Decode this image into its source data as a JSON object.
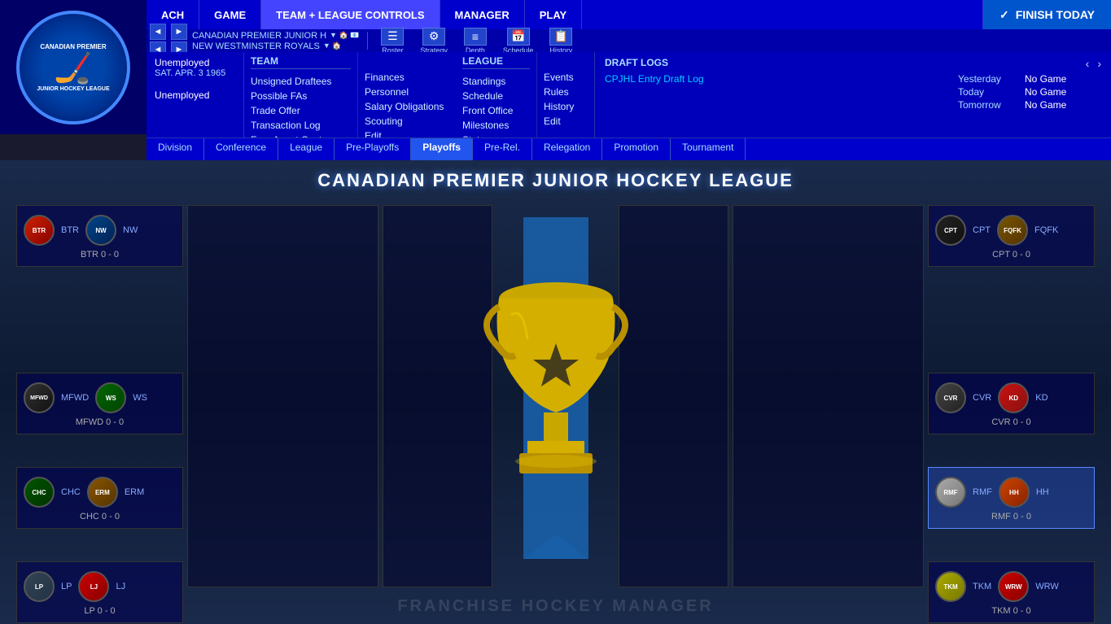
{
  "topNav": {
    "items": [
      {
        "label": "ACH",
        "active": false
      },
      {
        "label": "GAME",
        "active": false
      },
      {
        "label": "TEAM + LEAGUE CONTROLS",
        "active": true
      },
      {
        "label": "MANAGER",
        "active": false
      },
      {
        "label": "PLAY",
        "active": false
      }
    ],
    "finishToday": "FINISH TODAY"
  },
  "teamLinks": {
    "line1": "CANADIAN PREMIER JUNIOR H",
    "line2": "NEW WESTMINSTER ROYALS"
  },
  "toolbar": {
    "buttons": [
      "Roster",
      "Strategy",
      "Depth",
      "Schedule",
      "History"
    ]
  },
  "teamMenu": {
    "title": "TEAM",
    "items": [
      "Unsigned Draftees",
      "Possible FAs",
      "Trade Offer",
      "Transaction Log",
      "Free Agent Centre"
    ]
  },
  "leagueMenu": {
    "title": "LEAGUE",
    "items": [
      "Standings",
      "Schedule",
      "Front Office",
      "Milestones",
      "Stats"
    ]
  },
  "teamSubmenu": {
    "items": [
      "Finances",
      "Personnel",
      "Salary Obligations",
      "Scouting",
      "Edit"
    ]
  },
  "leagueSubmenu": {
    "items": [
      "Events",
      "Rules",
      "History",
      "Edit"
    ]
  },
  "draftLogs": {
    "title": "DRAFT LOGS",
    "link": "CPJHL Entry Draft Log"
  },
  "calendar": {
    "yesterday": {
      "label": "Yesterday",
      "value": "No Game"
    },
    "today": {
      "label": "Today",
      "value": "No Game"
    },
    "tomorrow": {
      "label": "Tomorrow",
      "value": "No Game"
    }
  },
  "userInfo": {
    "status": "Unemployed",
    "date": "SAT. APR. 3 1965",
    "role": "Unemployed"
  },
  "navTabs": {
    "items": [
      "Division",
      "Conference",
      "League",
      "Pre-Playoffs",
      "Playoffs",
      "Pre-Rel.",
      "Relegation",
      "Promotion",
      "Tournament"
    ],
    "active": "Playoffs"
  },
  "pageTitle": "CANADIAN PREMIER JUNIOR HOCKEY LEAGUE",
  "matchups": {
    "left": [
      {
        "team1": "BTR",
        "team2": "NW",
        "score": "BTR 0 - 0"
      },
      {
        "team1": "MFWD",
        "team2": "WS",
        "score": "MFWD 0 - 0"
      },
      {
        "team1": "CHC",
        "team2": "ERM",
        "score": "CHC 0 - 0"
      },
      {
        "team1": "LP",
        "team2": "LJ",
        "score": "LP 0 - 0"
      }
    ],
    "right": [
      {
        "team1": "CPT",
        "team2": "FQFK",
        "score": "CPT 0 - 0"
      },
      {
        "team1": "CVR",
        "team2": "KD",
        "score": "CVR 0 - 0"
      },
      {
        "team1": "RMF",
        "team2": "HH",
        "score": "RMF 0 - 0",
        "highlighted": true
      },
      {
        "team1": "TKM",
        "team2": "WRW",
        "score": "TKM 0 - 0"
      }
    ]
  },
  "watermark": "FRANCHISE HOCKEY MANAGER"
}
